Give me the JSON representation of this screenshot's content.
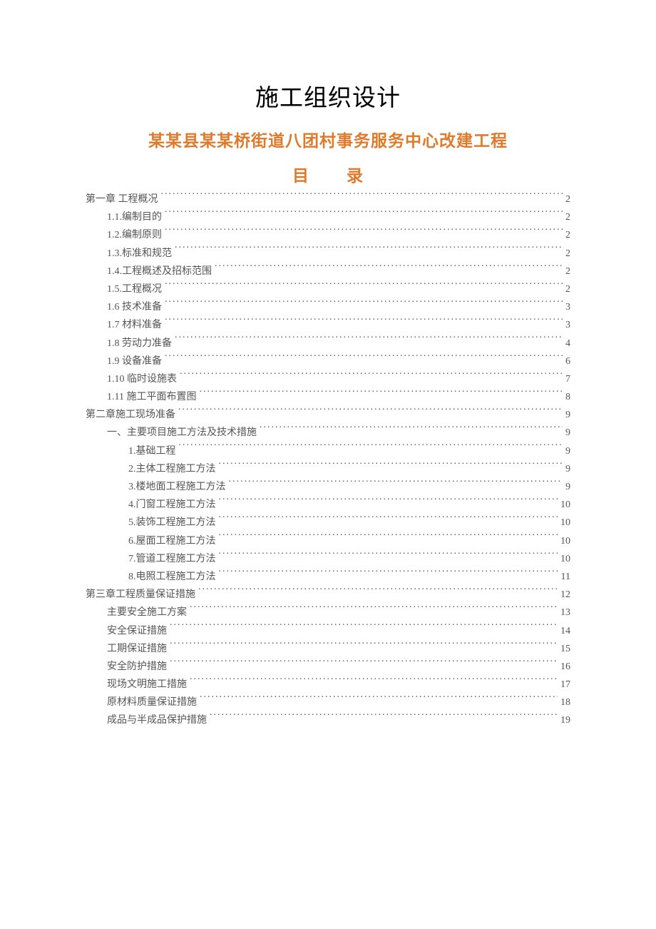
{
  "titles": {
    "main": "施工组织设计",
    "sub": "某某县某某桥街道八团村事务服务中心改建工程",
    "toc_left": "目",
    "toc_right": "录"
  },
  "toc": [
    {
      "level": 0,
      "label": "第一章  工程概况",
      "page": "2"
    },
    {
      "level": 1,
      "label": "1.1.编制目的",
      "page": "2"
    },
    {
      "level": 1,
      "label": "1.2.编制原则",
      "page": "2"
    },
    {
      "level": 1,
      "label": "1.3.标准和规范",
      "page": "2"
    },
    {
      "level": 1,
      "label": "1.4.工程概述及招标范围",
      "page": "2"
    },
    {
      "level": 1,
      "label": "1.5.工程概况",
      "page": "2"
    },
    {
      "level": 1,
      "label": "1.6 技术准备",
      "page": "3"
    },
    {
      "level": 1,
      "label": "1.7 材料准备",
      "page": "3"
    },
    {
      "level": 1,
      "label": "1.8 劳动力准备",
      "page": "4"
    },
    {
      "level": 1,
      "label": "1.9 设备准备",
      "page": "6"
    },
    {
      "level": 1,
      "label": "1.10  临时设施表",
      "page": "7"
    },
    {
      "level": 1,
      "label": "1.11  施工平面布置图",
      "page": "8"
    },
    {
      "level": 0,
      "label": "第二章施工现场准备",
      "page": "9"
    },
    {
      "level": 1,
      "label": "一、主要项目施工方法及技术措施",
      "page": "9"
    },
    {
      "level": 2,
      "label": "1.基础工程",
      "page": "9"
    },
    {
      "level": 2,
      "label": "2.主体工程施工方法",
      "page": "9"
    },
    {
      "level": 2,
      "label": "3.楼地面工程施工方法",
      "page": "9"
    },
    {
      "level": 2,
      "label": "4.门窗工程施工方法",
      "page": "10"
    },
    {
      "level": 2,
      "label": "5.装饰工程施工方法",
      "page": "10"
    },
    {
      "level": 2,
      "label": "6.屋面工程施工方法",
      "page": "10"
    },
    {
      "level": 2,
      "label": "7.管道工程施工方法",
      "page": "10"
    },
    {
      "level": 2,
      "label": "8.电照工程施工方法",
      "page": "11"
    },
    {
      "level": 0,
      "label": "第三章工程质量保证措施",
      "page": "12"
    },
    {
      "level": 1,
      "label": "主要安全施工方案",
      "page": "13"
    },
    {
      "level": 1,
      "label": "安全保证措施",
      "page": "14"
    },
    {
      "level": 1,
      "label": "工期保证措施",
      "page": "15"
    },
    {
      "level": 1,
      "label": "安全防护措施",
      "page": "16"
    },
    {
      "level": 1,
      "label": "现场文明施工措施",
      "page": "17"
    },
    {
      "level": 1,
      "label": "原材料质量保证措施",
      "page": "18"
    },
    {
      "level": 1,
      "label": "成品与半成品保护措施",
      "page": "19"
    }
  ]
}
